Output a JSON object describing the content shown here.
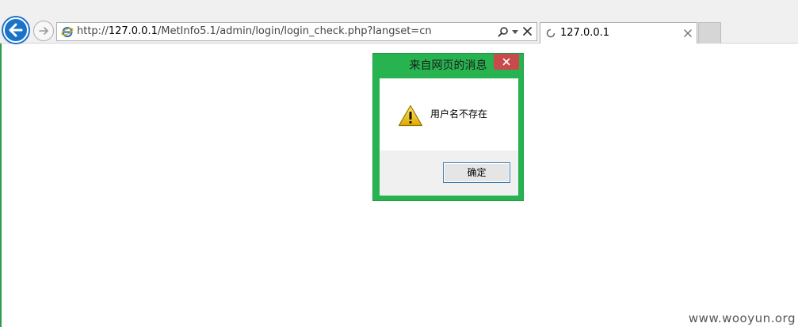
{
  "browser": {
    "url_prefix": "http://",
    "url_host": "127.0.0.1",
    "url_path": "/MetInfo5.1/admin/login/login_check.php?langset=cn",
    "tab_title": "127.0.0.1"
  },
  "dialog": {
    "title": "来自网页的消息",
    "message": "用户名不存在",
    "ok_label": "确定",
    "frame_color": "#27b450",
    "close_color": "#c94a4a"
  },
  "watermark": "www.wooyun.org",
  "icons": {
    "back": "back-arrow-icon",
    "forward": "forward-arrow-icon",
    "page": "ie-icon",
    "search": "search-icon",
    "dropdown": "chevron-down-icon",
    "stop": "stop-icon",
    "loading": "loading-icon",
    "tab_close": "close-icon",
    "dialog_close": "close-icon",
    "warning": "warning-icon"
  }
}
